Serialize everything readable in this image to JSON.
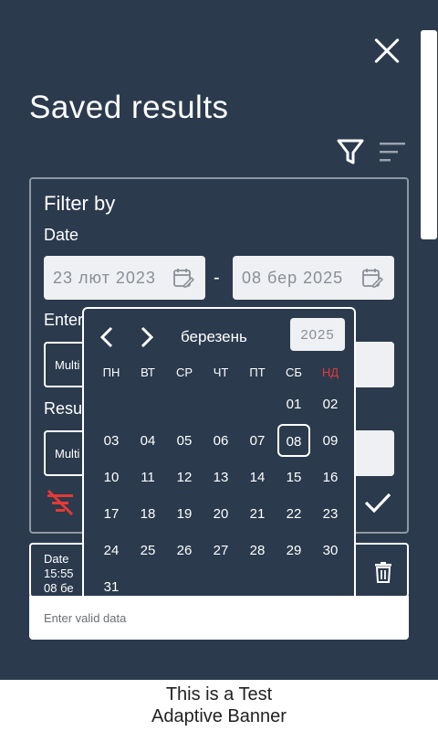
{
  "header": {
    "title": "Saved results"
  },
  "filter": {
    "title": "Filter by",
    "date_label": "Date",
    "date_from": "23 лют 2023",
    "date_to": "08 бер 2025",
    "dash": "-",
    "entry_label": "Enter",
    "result_label": "Resu",
    "multi_1": "Multi",
    "multi_2": "Multi"
  },
  "calendar": {
    "month": "березень",
    "year": "2025",
    "weekdays": [
      "ПН",
      "ВТ",
      "СР",
      "ЧТ",
      "ПТ",
      "СБ",
      "НД"
    ],
    "days": [
      "01",
      "02",
      "03",
      "04",
      "05",
      "06",
      "07",
      "08",
      "09",
      "10",
      "11",
      "12",
      "13",
      "14",
      "15",
      "16",
      "17",
      "18",
      "19",
      "20",
      "21",
      "22",
      "23",
      "24",
      "25",
      "26",
      "27",
      "28",
      "29",
      "30",
      "31"
    ],
    "selected_day": "08",
    "weekend_color": "#e53935"
  },
  "result_card": {
    "line1": "Date",
    "line2": "15:55",
    "line3": "08 бе"
  },
  "toast": {
    "message": "Enter valid data"
  },
  "banner": {
    "line1": "This is a Test",
    "line2": "Adaptive Banner"
  },
  "colors": {
    "background": "#2b3a4d",
    "clear_filter_icon": "#e53935"
  }
}
